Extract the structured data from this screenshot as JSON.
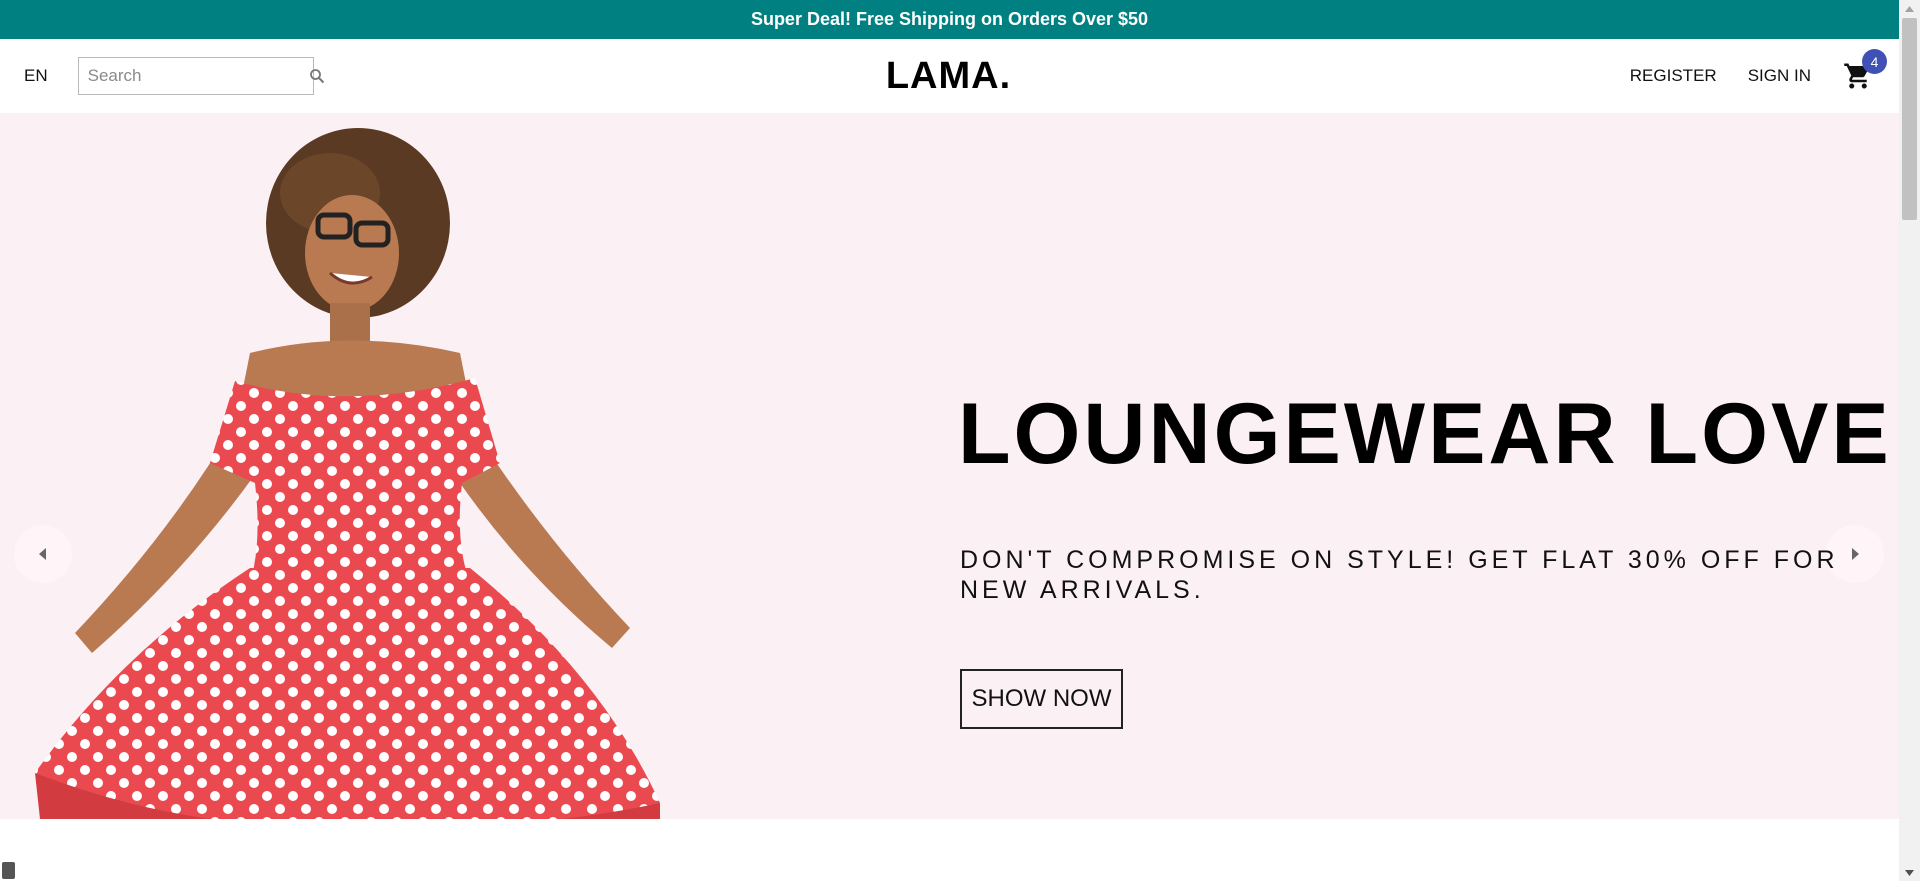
{
  "announcement": {
    "text": "Super Deal! Free Shipping on Orders Over $50"
  },
  "navbar": {
    "language": "EN",
    "search": {
      "placeholder": "Search",
      "value": ""
    },
    "logo": "LAMA.",
    "links": {
      "register": "REGISTER",
      "sign_in": "SIGN IN"
    },
    "cart": {
      "count": "4",
      "icon": "cart-icon"
    }
  },
  "hero": {
    "title": "LOUNGEWEAR LOVE",
    "description": "DON'T COMPROMISE ON STYLE! GET FLAT 30% OFF FOR NEW ARRIVALS.",
    "button_label": "SHOW NOW",
    "background_color": "#fbf0f4",
    "dress_color": "#ea4a4f"
  },
  "colors": {
    "announcement_bg": "#008080",
    "badge": "#3f51b5"
  }
}
